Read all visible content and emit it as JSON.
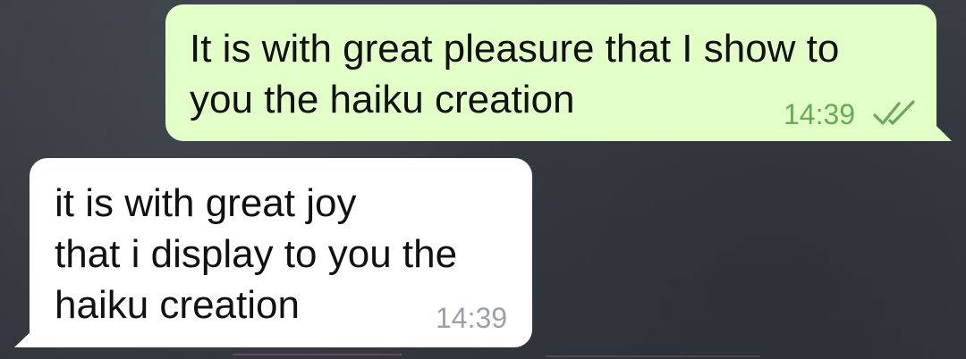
{
  "conversation": {
    "messages": [
      {
        "direction": "outgoing",
        "text": "It is with great pleasure that I show to\nyou the haiku creation",
        "time": "14:39",
        "status_icon": "double-check-icon"
      },
      {
        "direction": "incoming",
        "text": "it is with great joy\nthat i display to you the\nhaiku creation",
        "time": "14:39"
      }
    ]
  },
  "colors": {
    "background": "#363b42",
    "outgoing_bubble": "#e1ffc7",
    "incoming_bubble": "#ffffff",
    "outgoing_time": "#6aa85a",
    "incoming_time": "#9aa1a8"
  }
}
